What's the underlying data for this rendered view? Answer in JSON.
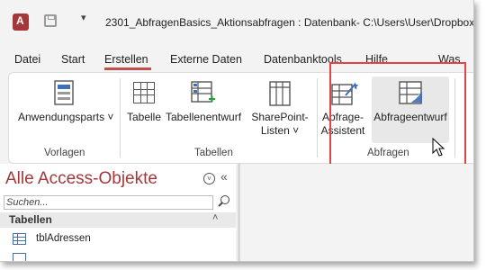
{
  "window": {
    "title": "2301_AbfragenBasics_Aktionsabfragen : Datenbank- C:\\Users\\User\\Dropbox\\"
  },
  "tabs": [
    {
      "label": "Datei"
    },
    {
      "label": "Start"
    },
    {
      "label": "Erstellen"
    },
    {
      "label": "Externe Daten"
    },
    {
      "label": "Datenbanktools"
    },
    {
      "label": "Hilfe"
    }
  ],
  "tell_me": "Was",
  "ribbon": {
    "vorlagen": {
      "group_label": "Vorlagen",
      "anwendungsparts": "Anwendungsparts ˅"
    },
    "tabellen": {
      "group_label": "Tabellen",
      "tabelle": "Tabelle",
      "tabellenentwurf": "Tabellenentwurf",
      "sharepoint_line1": "SharePoint-",
      "sharepoint_line2": "Listen ˅"
    },
    "abfragen": {
      "group_label": "Abfragen",
      "assistent_line1": "Abfrage-",
      "assistent_line2": "Assistent",
      "entwurf": "Abfrageentwurf"
    }
  },
  "nav": {
    "title": "Alle Access-Objekte",
    "search_placeholder": "Suchen...",
    "group_label": "Tabellen",
    "items": [
      {
        "label": "tblAdressen"
      }
    ]
  },
  "colors": {
    "accent": "#a4373a",
    "highlight": "#e04545"
  }
}
